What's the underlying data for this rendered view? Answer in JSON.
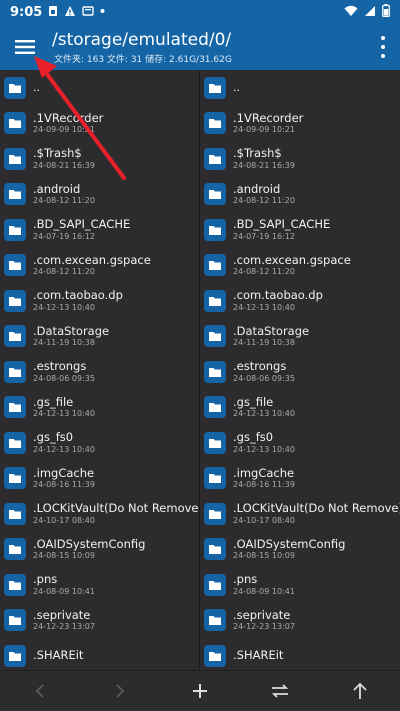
{
  "status_bar": {
    "time": "9:05"
  },
  "header": {
    "path": "/storage/emulated/0/",
    "stats": "文件夹: 163  文件: 31  储存: 2.61G/31.62G"
  },
  "left_panel": {
    "items": [
      {
        "name": "..",
        "date": ""
      },
      {
        "name": ".1VRecorder",
        "date": "24-09-09 10:21"
      },
      {
        "name": ".$Trash$",
        "date": "24-08-21 16:39"
      },
      {
        "name": ".android",
        "date": "24-08-12 11:20"
      },
      {
        "name": ".BD_SAPI_CACHE",
        "date": "24-07-19 16:12"
      },
      {
        "name": ".com.excean.gspace",
        "date": "24-08-12 11:20"
      },
      {
        "name": ".com.taobao.dp",
        "date": "24-12-13 10:40"
      },
      {
        "name": ".DataStorage",
        "date": "24-11-19 10:38"
      },
      {
        "name": ".estrongs",
        "date": "24-08-06 09:35"
      },
      {
        "name": ".gs_file",
        "date": "24-12-13 10:40"
      },
      {
        "name": ".gs_fs0",
        "date": "24-12-13 10:40"
      },
      {
        "name": ".imgCache",
        "date": "24-08-16 11:39"
      },
      {
        "name": ".LOCKitVault(Do Not Remove)",
        "date": "24-10-17 08:40"
      },
      {
        "name": ".OAIDSystemConfig",
        "date": "24-08-15 10:09"
      },
      {
        "name": ".pns",
        "date": "24-08-09 10:41"
      },
      {
        "name": ".seprivate",
        "date": "24-12-23 13:07"
      },
      {
        "name": ".SHAREit",
        "date": ""
      }
    ]
  },
  "right_panel": {
    "items": [
      {
        "name": "..",
        "date": ""
      },
      {
        "name": ".1VRecorder",
        "date": "24-09-09 10:21"
      },
      {
        "name": ".$Trash$",
        "date": "24-08-21 16:39"
      },
      {
        "name": ".android",
        "date": "24-08-12 11:20"
      },
      {
        "name": ".BD_SAPI_CACHE",
        "date": "24-07-19 16:12"
      },
      {
        "name": ".com.excean.gspace",
        "date": "24-08-12 11:20"
      },
      {
        "name": ".com.taobao.dp",
        "date": "24-12-13 10:40"
      },
      {
        "name": ".DataStorage",
        "date": "24-11-19 10:38"
      },
      {
        "name": ".estrongs",
        "date": "24-08-06 09:35"
      },
      {
        "name": ".gs_file",
        "date": "24-12-13 10:40"
      },
      {
        "name": ".gs_fs0",
        "date": "24-12-13 10:40"
      },
      {
        "name": ".imgCache",
        "date": "24-08-16 11:39"
      },
      {
        "name": ".LOCKitVault(Do Not Remove)",
        "date": "24-10-17 08:40"
      },
      {
        "name": ".OAIDSystemConfig",
        "date": "24-08-15 10:09"
      },
      {
        "name": ".pns",
        "date": "24-08-09 10:41"
      },
      {
        "name": ".seprivate",
        "date": "24-12-23 13:07"
      },
      {
        "name": ".SHAREit",
        "date": ""
      }
    ]
  },
  "bottom_bar": {
    "icons": [
      "back-icon",
      "forward-icon",
      "add-icon",
      "swap-panels-icon",
      "up-arrow-icon"
    ]
  },
  "colors": {
    "header": "#1565a6",
    "background": "#2c2c2e",
    "annotation_arrow": "#e8202a"
  }
}
